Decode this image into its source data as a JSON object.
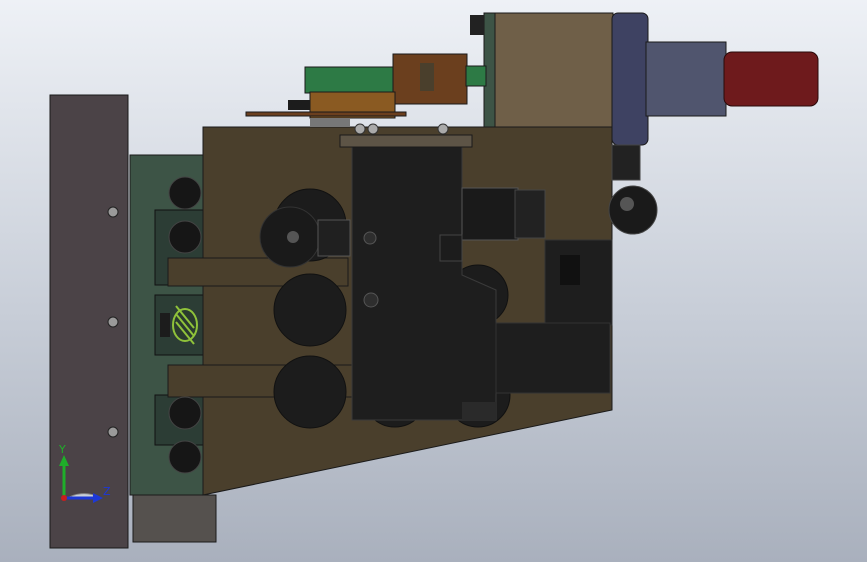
{
  "viewport": {
    "background_top": "#eef1f6",
    "background_bottom": "#a9b0bd"
  },
  "triad": {
    "y_label": "Y",
    "z_label": "Z",
    "y_color": "#1fae2a",
    "z_color": "#1d38d6",
    "x_color": "#c81e1e"
  },
  "colors": {
    "main_body": "#4a3f2c",
    "left_plate": "#4b4347",
    "green_plate": "#3d5446",
    "black_block": "#1e1e1e",
    "tan_block": "#6f5f48",
    "motor_flange": "#3e4262",
    "motor_red": "#6e1a1c",
    "green_bracket": "#2d7a45",
    "orange_part": "#8a5a22",
    "brown_part": "#6b3f1e",
    "spring_green": "#8fc23a"
  }
}
